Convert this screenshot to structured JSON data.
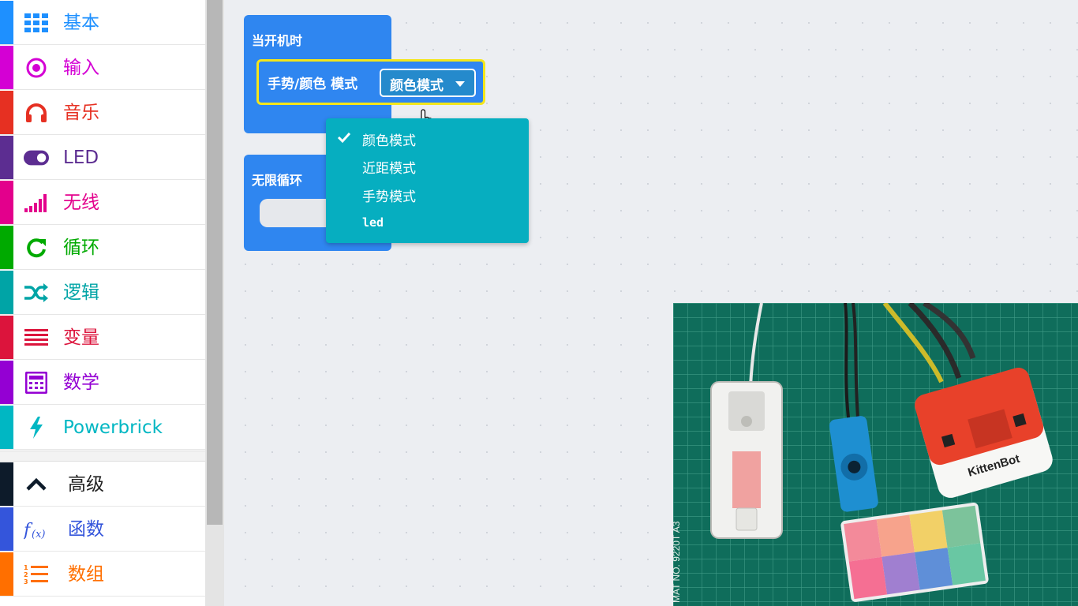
{
  "toolbox": {
    "categories": [
      {
        "label": "基本",
        "color": "#1e90ff",
        "icon": "grid-icon"
      },
      {
        "label": "输入",
        "color": "#d400d4",
        "icon": "target-icon"
      },
      {
        "label": "音乐",
        "color": "#e63022",
        "icon": "headphones-icon"
      },
      {
        "label": "LED",
        "color": "#5c2d91",
        "icon": "toggle-icon"
      },
      {
        "label": "无线",
        "color": "#e3008c",
        "icon": "signal-bars-icon"
      },
      {
        "label": "循环",
        "color": "#00aa00",
        "icon": "refresh-icon"
      },
      {
        "label": "逻辑",
        "color": "#00a4a6",
        "icon": "shuffle-icon"
      },
      {
        "label": "变量",
        "color": "#dc143c",
        "icon": "list-lines-icon"
      },
      {
        "label": "数学",
        "color": "#9400d3",
        "icon": "calculator-icon"
      },
      {
        "label": "Powerbrick",
        "color": "#00b7c3",
        "icon": "lightning-icon"
      }
    ],
    "advanced": {
      "label": "高级",
      "color": "#0d1b2a",
      "icon": "chevron-up-icon"
    },
    "advanced_categories": [
      {
        "label": "函数",
        "color": "#3455db",
        "icon": "function-icon"
      },
      {
        "label": "数组",
        "color": "#ff6f00",
        "icon": "numbered-list-icon"
      }
    ]
  },
  "workspace": {
    "on_start": {
      "title": "当开机时",
      "statement": {
        "label": "手势/颜色 模式",
        "dropdown_value": "颜色模式"
      }
    },
    "forever": {
      "title": "无限循环"
    },
    "dropdown_menu": {
      "options": [
        {
          "label": "颜色模式",
          "selected": true
        },
        {
          "label": "近距模式",
          "selected": false
        },
        {
          "label": "手势模式",
          "selected": false
        },
        {
          "label": "led",
          "selected": false
        }
      ]
    }
  },
  "camera_overlay": {
    "device_label": "KittenBot",
    "mat_text": "MAT  NO. 9220T  A3",
    "color_card": [
      "#f38a9a",
      "#f7a38c",
      "#f2d067",
      "#7cc39b",
      "#f56f93",
      "#a07fd0",
      "#5f8fd8",
      "#69c7a3"
    ]
  }
}
